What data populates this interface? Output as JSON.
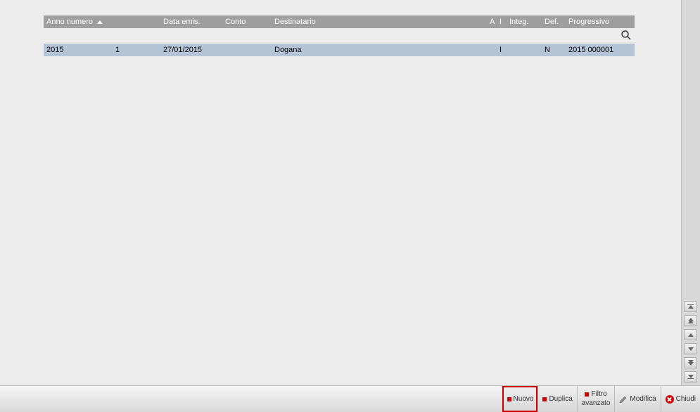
{
  "columns": {
    "anno_numero": "Anno numero",
    "data_emis": "Data emis.",
    "conto": "Conto",
    "destinatario": "Destinatario",
    "a": "A",
    "i": "I",
    "integ": "Integ.",
    "def": "Def.",
    "progressivo": "Progressivo"
  },
  "rows": [
    {
      "anno": "2015",
      "numero": "1",
      "data_emis": "27/01/2015",
      "conto": "",
      "destinatario": "Dogana",
      "a": "",
      "i": "I",
      "integ": "",
      "def": "N",
      "progressivo": "2015 000001"
    }
  ],
  "toolbar": {
    "nuovo": "Nuovo",
    "duplica": "Duplica",
    "filtro_line1": "Filtro",
    "filtro_line2": "avanzato",
    "modifica": "Modifica",
    "chiudi": "Chiudi"
  }
}
